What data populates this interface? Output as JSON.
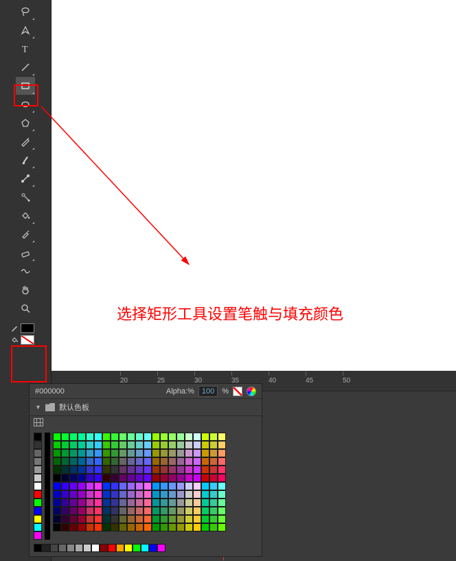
{
  "toolbar": {
    "tools": [
      {
        "name": "lasso-icon"
      },
      {
        "name": "pen-icon"
      },
      {
        "name": "text-icon"
      },
      {
        "name": "line-icon"
      },
      {
        "name": "rectangle-icon",
        "selected": true
      },
      {
        "name": "ellipse-icon"
      },
      {
        "name": "polygon-icon"
      },
      {
        "name": "pencil-icon"
      },
      {
        "name": "brush-icon"
      },
      {
        "name": "bone-icon"
      },
      {
        "name": "tweak-icon"
      },
      {
        "name": "paint-bucket-icon"
      },
      {
        "name": "eyedropper-icon"
      },
      {
        "name": "eraser-icon"
      },
      {
        "name": "width-icon"
      },
      {
        "name": "hand-icon"
      },
      {
        "name": "zoom-icon"
      }
    ],
    "stroke_color": "#000000",
    "fill_color": "none"
  },
  "colorpanel": {
    "hex": "#000000",
    "alpha_label": "Alpha:%",
    "alpha_value": "100",
    "alpha_suffix": "%",
    "title": "默认色板",
    "grayscale": [
      "#000000",
      "#333333",
      "#666666",
      "#777777",
      "#999999",
      "#cccccc",
      "#ffffff"
    ],
    "primary": [
      "#ff0000",
      "#00ff00",
      "#0000ff",
      "#ffff00",
      "#00ffff",
      "#ff00ff"
    ],
    "bottom_row": [
      "#000000",
      "#222222",
      "#444444",
      "#666666",
      "#888888",
      "#aaaaaa",
      "#cccccc",
      "#ffffff",
      "#8b0000",
      "#ff0000",
      "#ffa500",
      "#ffff00",
      "#00ff00",
      "#00ffff",
      "#0000ff",
      "#ff00ff"
    ]
  },
  "timeline": {
    "marks": [
      "20",
      "25",
      "30",
      "35",
      "40",
      "45",
      "50"
    ]
  },
  "annotation": {
    "text": "选择矩形工具设置笔触与填充颜色"
  }
}
